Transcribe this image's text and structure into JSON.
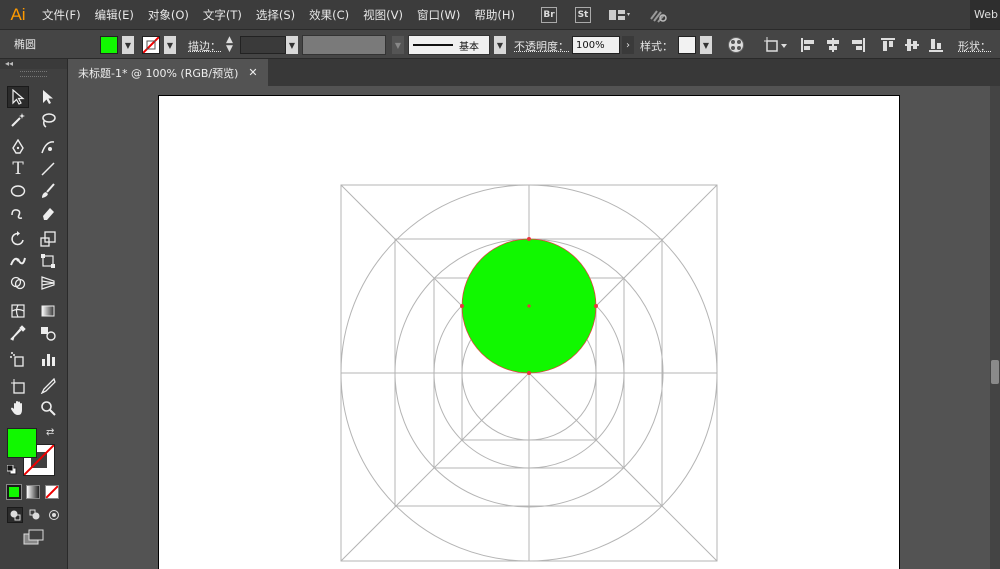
{
  "app": {
    "logo": "Ai"
  },
  "menu": [
    "文件(F)",
    "编辑(E)",
    "对象(O)",
    "文字(T)",
    "选择(S)",
    "效果(C)",
    "视图(V)",
    "窗口(W)",
    "帮助(H)"
  ],
  "menu_icons": {
    "bridge": "Br",
    "stock": "St"
  },
  "workspace": "Web",
  "control": {
    "object_type": "椭圆",
    "fill_color": "#11f800",
    "stroke_label": "描边：",
    "style_line_label": "基本",
    "opacity_label": "不透明度：",
    "opacity_value": "100%",
    "style_label": "样式：",
    "shape_label": "形状："
  },
  "document": {
    "tab_title": "未标题-1* @ 100% (RGB/预览)"
  },
  "colors": {
    "ellipse_fill": "#11f800",
    "guide_stroke": "#b4b4b4",
    "anchor": "#e8383d",
    "brand": "#ff9a00"
  }
}
